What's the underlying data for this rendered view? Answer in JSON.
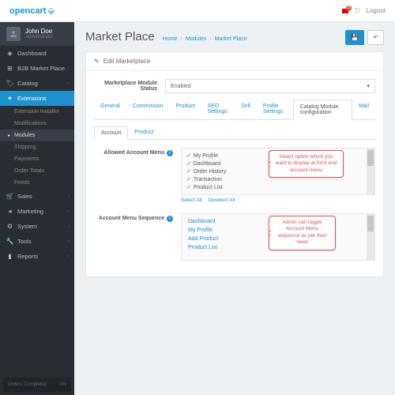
{
  "brand": {
    "name": "opencart"
  },
  "topbar": {
    "logout": "Logout",
    "notif": "0"
  },
  "user": {
    "name": "John Doe",
    "role": "Administrator"
  },
  "nav": {
    "dashboard": "Dashboard",
    "b2b": "B2B Market Place",
    "catalog": "Catalog",
    "extensions": "Extensions",
    "ext_installer": "Extension Installer",
    "modifications": "Modifications",
    "modules": "Modules",
    "shipping": "Shipping",
    "payments": "Payments",
    "order_totals": "Order Totals",
    "feeds": "Feeds",
    "sales": "Sales",
    "marketing": "Marketing",
    "system": "System",
    "tools": "Tools",
    "reports": "Reports"
  },
  "orders_box": {
    "label": "Orders Completed",
    "value": "0%"
  },
  "page": {
    "title": "Market Place",
    "crumbs": {
      "home": "Home",
      "modules": "Modules",
      "current": "Market Place"
    }
  },
  "panel": {
    "title": "Edit Marketplace"
  },
  "form": {
    "status_label": "Marketplace Module Status",
    "status_value": "Enabled"
  },
  "tabs": {
    "general": "General",
    "commission": "Commission",
    "product": "Product",
    "seo": "SEO Settings",
    "sell": "Sell",
    "profile": "Profile Settings",
    "catalog_module": "Catalog Module configuration",
    "mail": "Mail"
  },
  "subtabs": {
    "account": "Account",
    "product": "Product"
  },
  "fields": {
    "allowed_menu": "Allowed Account Menu",
    "sequence": "Account Menu Sequence",
    "select_all": "Select All",
    "deselect_all": "Deselect All"
  },
  "menu_items": {
    "my_profile": "My Profile",
    "dashboard": "Dashboard",
    "order_history": "Order History",
    "transaction": "Transaction",
    "product_list": "Product List"
  },
  "sequence_items": {
    "dashboard": "Dashboard",
    "my_profile": "My Profile",
    "add_product": "Add Product",
    "product_list": "Product List"
  },
  "callouts": {
    "c1": "Select option which you want to display at front end account menu",
    "c2": "Admin can toggle Account Menu sequence as per their need"
  }
}
